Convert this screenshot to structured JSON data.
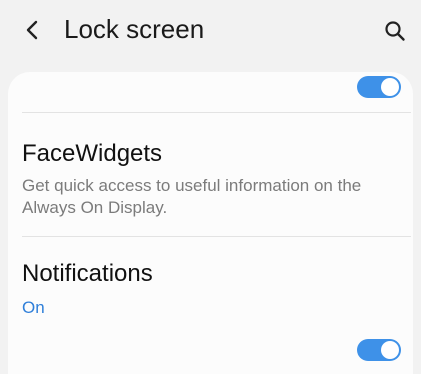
{
  "header": {
    "title": "Lock screen",
    "back_icon": "back-chevron-icon",
    "search_icon": "search-icon"
  },
  "settings": {
    "top_toggle": {
      "state": "on"
    },
    "facewidgets": {
      "title": "FaceWidgets",
      "description": "Get quick access to useful information on the Always On Display."
    },
    "notifications": {
      "title": "Notifications",
      "status": "On",
      "toggle_state": "on"
    }
  },
  "colors": {
    "accent": "#3e91e8",
    "status_text": "#2f7fd9",
    "background": "#f2f2f2",
    "card": "#fcfcfc"
  }
}
